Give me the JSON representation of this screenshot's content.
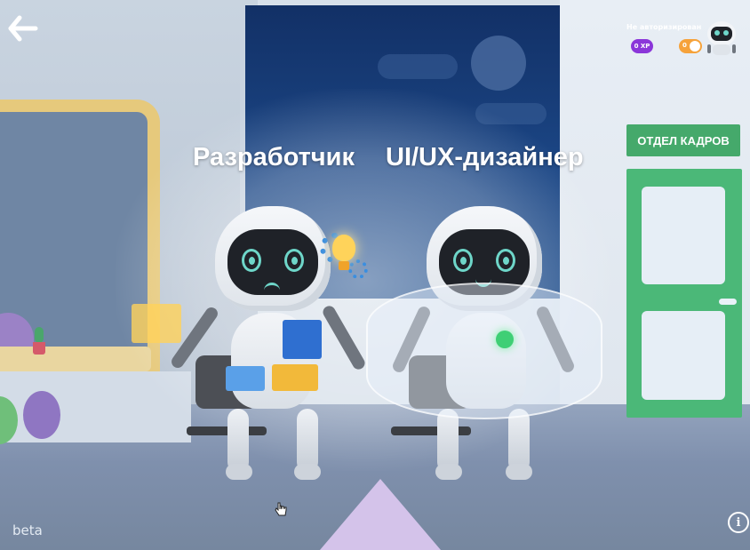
{
  "nav": {
    "back_icon": "arrow-left-icon"
  },
  "roles": [
    {
      "label": "Разработчик"
    },
    {
      "label": "UI/UX-дизайнер"
    }
  ],
  "user": {
    "status": "Не авторизирован",
    "xp": "0 XP",
    "coins": "0",
    "avatar_icon": "robot-avatar-icon"
  },
  "scene": {
    "hr_sign": "ОТДЕЛ КАДРОВ"
  },
  "footer": {
    "beta": "beta",
    "info": "i"
  },
  "colors": {
    "accent_purple": "#8b36d9",
    "accent_orange": "#f6a23a",
    "hr_green": "#45a96b",
    "face_glow": "#6ed6c9"
  }
}
